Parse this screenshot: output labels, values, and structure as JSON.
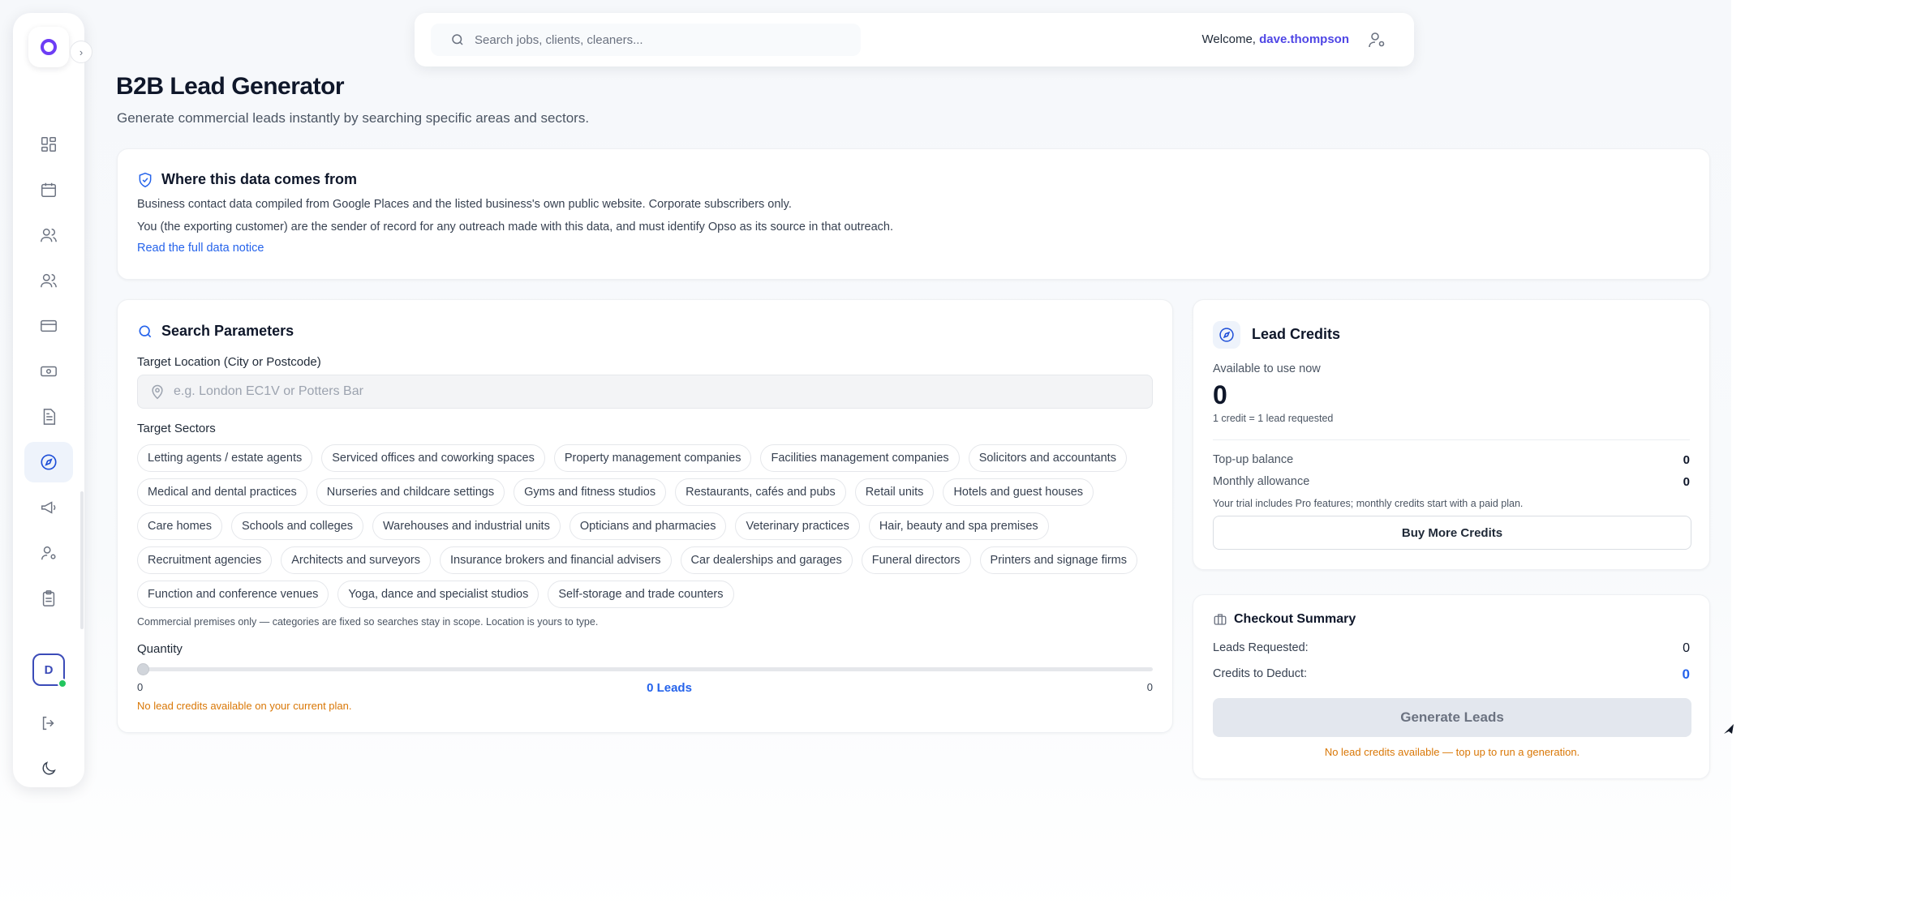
{
  "topbar": {
    "search_placeholder": "Search jobs, clients, cleaners...",
    "welcome_prefix": "Welcome,",
    "username": "dave.thompson"
  },
  "sidebar": {
    "avatar_initial": "D",
    "items": [
      {
        "icon": "dashboard-icon"
      },
      {
        "icon": "calendar-icon"
      },
      {
        "icon": "users-icon"
      },
      {
        "icon": "team-icon"
      },
      {
        "icon": "credit-card-icon"
      },
      {
        "icon": "cash-icon"
      },
      {
        "icon": "document-icon"
      },
      {
        "icon": "compass-icon",
        "active": true
      },
      {
        "icon": "megaphone-icon"
      },
      {
        "icon": "user-settings-icon"
      },
      {
        "icon": "clipboard-icon"
      }
    ],
    "bottom": [
      {
        "icon": "logout-icon"
      },
      {
        "icon": "moon-icon"
      }
    ]
  },
  "header": {
    "title": "B2B Lead Generator",
    "subtitle": "Generate commercial leads instantly by searching specific areas and sectors."
  },
  "notice": {
    "title": "Where this data comes from",
    "line1": "Business contact data compiled from Google Places and the listed business's own public website. Corporate subscribers only.",
    "line2": "You (the exporting customer) are the sender of record for any outreach made with this data, and must identify Opso as its source in that outreach.",
    "link": "Read the full data notice"
  },
  "search": {
    "title": "Search Parameters",
    "location_label": "Target Location (City or Postcode)",
    "location_placeholder": "e.g. London EC1V or Potters Bar",
    "sectors_label": "Target Sectors",
    "sectors": [
      "Letting agents / estate agents",
      "Serviced offices and coworking spaces",
      "Property management companies",
      "Facilities management companies",
      "Solicitors and accountants",
      "Medical and dental practices",
      "Nurseries and childcare settings",
      "Gyms and fitness studios",
      "Restaurants, cafés and pubs",
      "Retail units",
      "Hotels and guest houses",
      "Care homes",
      "Schools and colleges",
      "Warehouses and industrial units",
      "Opticians and pharmacies",
      "Veterinary practices",
      "Hair, beauty and spa premises",
      "Recruitment agencies",
      "Architects and surveyors",
      "Insurance brokers and financial advisers",
      "Car dealerships and garages",
      "Funeral directors",
      "Printers and signage firms",
      "Function and conference venues",
      "Yoga, dance and specialist studios",
      "Self-storage and trade counters"
    ],
    "hint": "Commercial premises only — categories are fixed so searches stay in scope. Location is yours to type.",
    "quantity_label": "Quantity",
    "slider_min": "0",
    "slider_max": "0",
    "slider_value_text": "0 Leads",
    "slider_fraction": 0,
    "warning": "No lead credits available on your current plan."
  },
  "credits": {
    "title": "Lead Credits",
    "available_label": "Available to use now",
    "available_value": "0",
    "rate_note": "1 credit = 1 lead requested",
    "topup_label": "Top-up balance",
    "topup_value": "0",
    "monthly_label": "Monthly allowance",
    "monthly_value": "0",
    "trial_note": "Your trial includes Pro features; monthly credits start with a paid plan.",
    "buy_button": "Buy More Credits"
  },
  "checkout": {
    "title": "Checkout Summary",
    "requested_label": "Leads Requested:",
    "requested_value": "0",
    "deduct_label": "Credits to Deduct:",
    "deduct_value": "0",
    "generate_button": "Generate Leads",
    "warning": "No lead credits available — top up to run a generation."
  },
  "colors": {
    "accent": "#2563eb",
    "brand": "#6d3df5",
    "warning": "#d97706",
    "online": "#22c55e"
  }
}
